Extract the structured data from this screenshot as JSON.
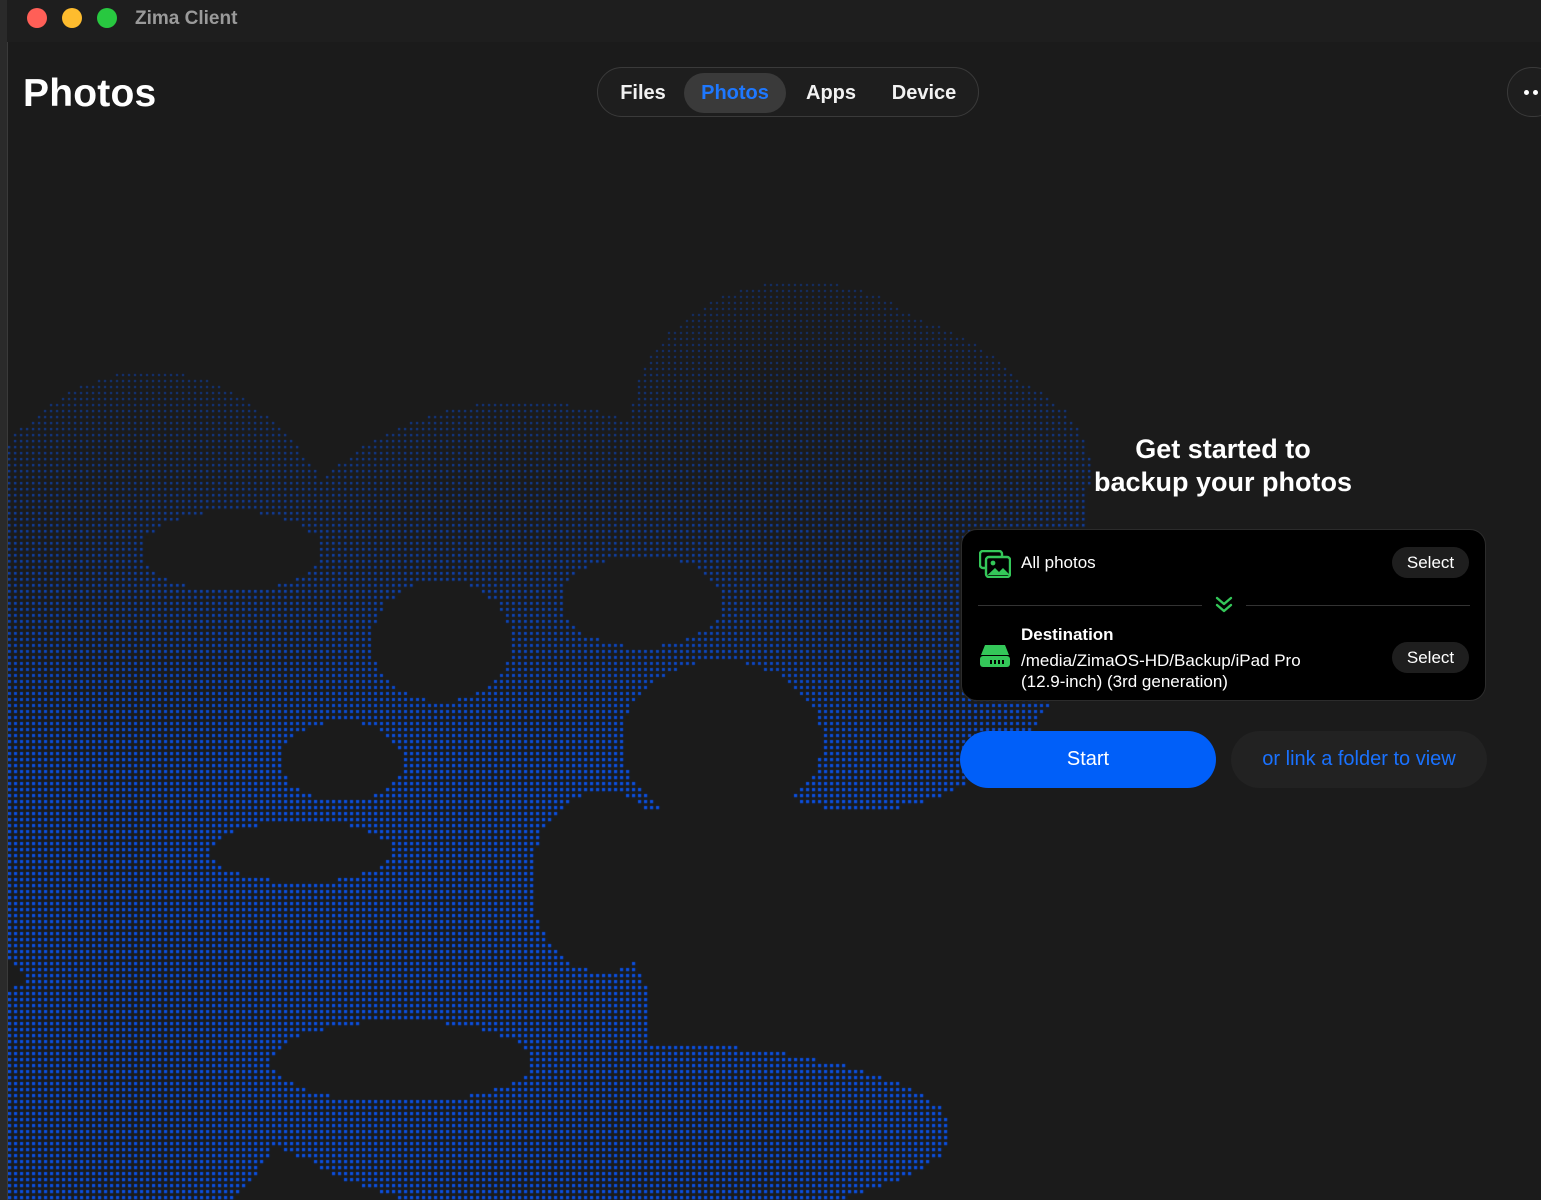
{
  "window": {
    "title": "Zima Client",
    "traffic_lights": {
      "close": "#ff5f57",
      "minimize": "#febc2e",
      "zoom": "#28c840"
    }
  },
  "page": {
    "title": "Photos"
  },
  "nav": {
    "tabs": [
      {
        "label": "Files",
        "active": false
      },
      {
        "label": "Photos",
        "active": true
      },
      {
        "label": "Apps",
        "active": false
      },
      {
        "label": "Device",
        "active": false
      }
    ],
    "more_icon": "more-dots-icon"
  },
  "backup": {
    "headline_line1": "Get started to",
    "headline_line2": "backup your photos",
    "source": {
      "icon": "photos-icon",
      "label": "All photos",
      "select_label": "Select"
    },
    "arrow_icon": "double-chevron-down-icon",
    "destination": {
      "icon": "drive-icon",
      "title": "Destination",
      "path": "/media/ZimaOS-HD/Backup/iPad Pro (12.9-inch) (3rd generation)",
      "select_label": "Select"
    },
    "start_label": "Start",
    "link_label": "or link a folder to view"
  },
  "colors": {
    "background": "#1b1b1b",
    "accent_blue": "#005ff9",
    "link_blue": "#1a72ff",
    "icon_green": "#34c759",
    "dot_blue": "#0a4fe0"
  }
}
